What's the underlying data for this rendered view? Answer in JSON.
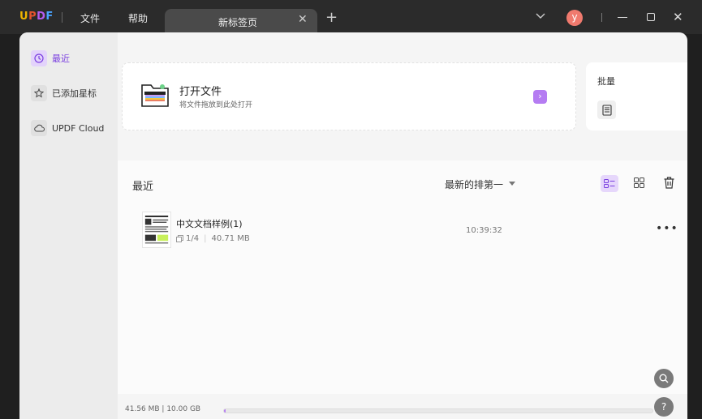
{
  "app": {
    "logo": "UPDF",
    "menu": [
      "文件",
      "帮助"
    ],
    "tab_title": "新标签页",
    "avatar_letter": "y"
  },
  "sidebar": {
    "items": [
      {
        "label": "最近",
        "icon": "clock-icon",
        "active": true
      },
      {
        "label": "已添加星标",
        "icon": "star-icon",
        "active": false
      },
      {
        "label": "UPDF Cloud",
        "icon": "cloud-icon",
        "active": false
      }
    ]
  },
  "open_file": {
    "title": "打开文件",
    "subtitle": "将文件拖放到此处打开"
  },
  "batch": {
    "title": "批量"
  },
  "recent": {
    "title": "最近",
    "sort_label": "最新的排第一"
  },
  "files": [
    {
      "name": "中文文档样例(1)",
      "pages": "1/4",
      "size": "40.71 MB",
      "time": "10:39:32"
    }
  ],
  "storage": {
    "text": "41.56 MB | 10.00 GB",
    "used_fraction": 0.004
  },
  "colors": {
    "accent": "#b57cf2",
    "accent_text": "#7a3fe0"
  }
}
